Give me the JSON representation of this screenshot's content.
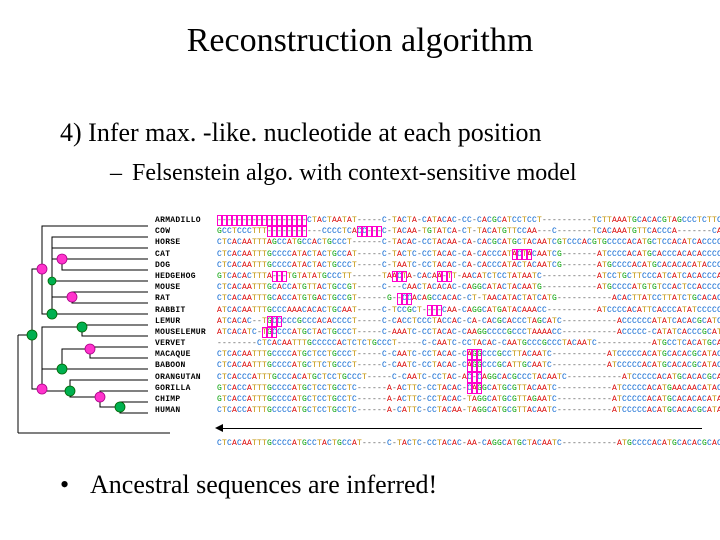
{
  "title": "Reconstruction algorithm",
  "point4": "4) Infer max. -like. nucleotide at each position",
  "subpoint_dash": "–",
  "subpoint": "Felsenstein algo. with context-sensitive model",
  "bullet_dot": "•",
  "bullet": "Ancestral sequences are inferred!",
  "species": [
    "ARMADILLO",
    "COW",
    "HORSE",
    "CAT",
    "DOG",
    "HEDGEHOG",
    "MOUSE",
    "RAT",
    "RABBIT",
    "LEMUR",
    "MOUSELEMUR",
    "VERVET",
    "MACAQUE",
    "BABOON",
    "ORANGUTAN",
    "GORILLA",
    "CHIMP",
    "HUMAN"
  ],
  "sequences": [
    "------------------CTACTAATAT-----C-TACTA-CATACAC-CC-CACGCATCCTCCT----------TCTTAAATGCACACGTAGCCCTCTTC",
    "GCCTCCCTTT-----------CCCCTCACC---C-TACAA-TGTATCA-CT-TACATGTTCCAA---C-------TCACAAATGTTCACCCA-------CAT",
    "CTCACAATTTAGCCATGCCACTGCCCT------C-TACAC-CCTACAA-CA-CACGCATGCTACAATCGTCCCACGTGCCCCACATGCTCCACATCACCCCTAC",
    "CTCACAATTTGCCCCATACTACTGCCAT-----C-TACTC-CCTACAC-CA-CACCCATACTACAATCG-------ATCCCCACATGCACCCACACACCCCTAC",
    "CTCACAATTTGCCCCATACTACTGCCCT-----C-TAATC-CCTACAC-CA-CACCCATACTACAATCG-------ATGCCCCACATGCACACACATACCCCTAC",
    "GTCACACTTTA---TGTATATGCCCTT------TAACTA-CACAA-TT-AACATCTCCTATAATC-----------ATCCTGCTTCCCATCATCACACCCAC",
    "CTCACAATTTGCACCATGTTACTGCCGT-----C---CAACTACACAC-CAGGCATACTACAATG-----------ATGCCCCATGTGTCCACTCCACCCCAC",
    "CTCACAATTTGCACCATGTGACTGCCGT------G--CCACAGCCACAC-CT-TAACATACTATCATG-----------ACACTTATCCTTATCTGCACACCCCCCAC",
    "ATCACAATTTGCCCAAACACACTGCAAT-----C-TCCGCT----CAA-CAGGCATGATACAAACC----------ATCCCCACATTCACCCATATCCCCCCAC",
    "ATCACAC--TGCCCCCGCCCACACCCCT-----C-CACCTCCCTACCAC-CA-CACGCACCCTAGCATC-----------ACCCCCCATATCACACGCATCCC-CCAC",
    "ATCACATC-TGCCCCATGCTACTGCCCT-----C-AAATC-CCTACAC-CAAGGCCCCGCCCTAAAACC-----------ACCCCC-CATATCACCCGCATATCCCTCAC",
    "--------CTCACAATTTGCCCCCACTCTCTGCCCT-----C-CAATC-CCTACAC-CAATGCCCGCCCTACAATC-----------ATGCCTCACATGCACACGCACACCCCCAC",
    "CTCACAATTTGCCCCATGCTCCTGCCCT-----C-CAATC-CCTACAC-CAGGCCCGCCTTACAATC-----------ATCCCCCACATGCACACGCATACCCCCAC",
    "CTCACAATTTGCCCCATGCTTCTGCCCT-----C-CAATC-CCTACAC-CAGGCCCGCATTGCAATC-----------ATCCCCCACATGCACACGCATACCCCCAC",
    "CTCACCCATTTGCCCACATGCTCCTGCCCT-----C-CAATC-CCTAC-AC-CAGGCACGCCCTACAATC-----------ATCCCCCACATGCACACGCATACCCCCAC",
    "GTCACCATTTGCCCCATGCTCCTGCCTC------A-ACTTC-CCTACAC-CAGGCATGCGTTACAATC-----------ATCCCCCACATGAACAACATACCCCCAC",
    "GTCACCATTTGCCCCATGCTCCTGCCTC------A-ACTTC-CCTACAC-TAGGCATGCGTTAGAATC-----------ATCCCCCACATGCACACACATACCCCCAC",
    "CTCACCATTTGCCCCATGCTCCTGCCTC------A-CATTC-CCTACAA-TAGGCATGCGTTACAATC-----------ATCCCCCACATGCACACGCATACCCCCAC"
  ],
  "highlight_boxes": [
    {
      "row": 0,
      "start": 0,
      "end": 17
    },
    {
      "row": 1,
      "start": 10,
      "end": 17
    },
    {
      "row": 1,
      "start": 28,
      "end": 32
    },
    {
      "row": 3,
      "start": 59,
      "end": 62
    },
    {
      "row": 5,
      "start": 11,
      "end": 13
    },
    {
      "row": 5,
      "start": 35,
      "end": 37
    },
    {
      "row": 5,
      "start": 44,
      "end": 46
    },
    {
      "row": 7,
      "start": 36,
      "end": 38
    },
    {
      "row": 8,
      "start": 42,
      "end": 44
    },
    {
      "row": 9,
      "start": 10,
      "end": 12
    },
    {
      "row": 10,
      "start": 9,
      "end": 11
    },
    {
      "row": 12,
      "start": 50,
      "end": 52
    },
    {
      "row": 13,
      "start": 50,
      "end": 52
    },
    {
      "row": 14,
      "start": 50,
      "end": 52
    },
    {
      "row": 15,
      "start": 50,
      "end": 52
    }
  ],
  "inferred_label": "",
  "inferred_seq": "CTCACAATTTGCCCCATGCCTACTGCCAT-----C-TACTC-CCTACAC-AA-CAGGCATGCTACAATC-----------ATGCCCCACATGCACACGCACATCCCCCCAC"
}
